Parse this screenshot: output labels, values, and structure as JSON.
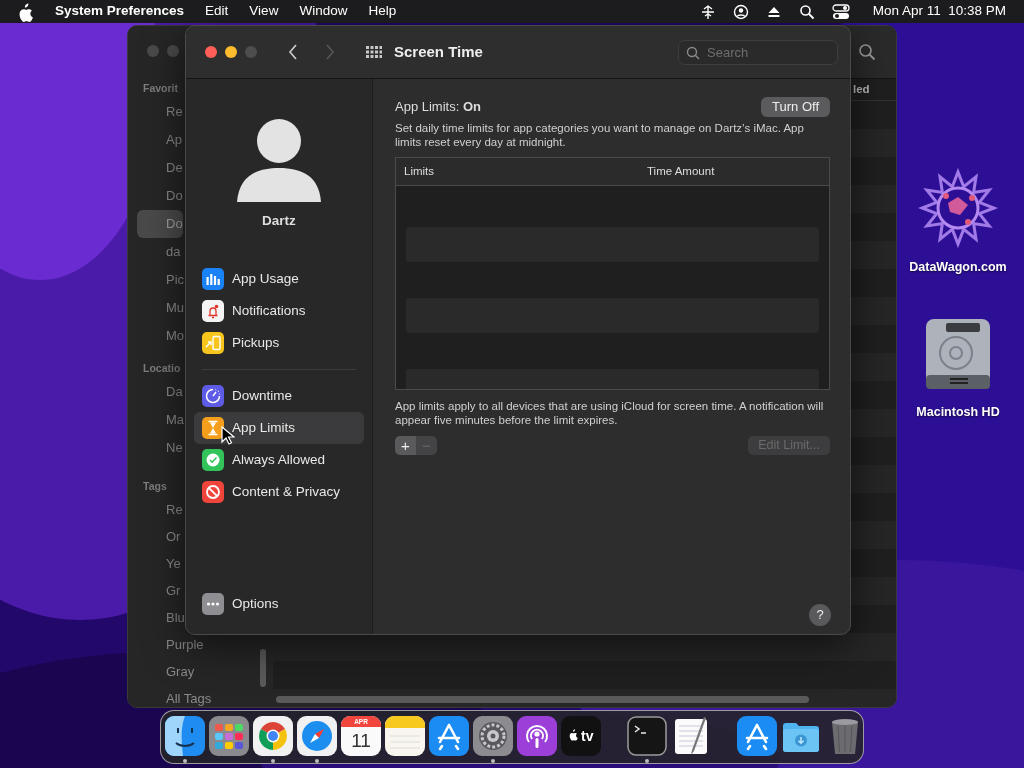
{
  "menu_bar": {
    "app_name": "System Preferences",
    "menus": [
      "Edit",
      "View",
      "Window",
      "Help"
    ],
    "clock": "Mon Apr 11  10:38 PM"
  },
  "finder_window": {
    "active": false,
    "sidebar": [
      {
        "heading": "Favorit",
        "items": [
          {
            "label": "Re",
            "selected": false
          },
          {
            "label": "Ap",
            "selected": false
          },
          {
            "label": "De",
            "selected": false
          },
          {
            "label": "Do",
            "selected": false
          },
          {
            "label": "Do",
            "selected": true
          },
          {
            "label": "da",
            "selected": false
          },
          {
            "label": "Pic",
            "selected": false
          },
          {
            "label": "Mu",
            "selected": false
          },
          {
            "label": "Mo",
            "selected": false
          }
        ]
      },
      {
        "heading": "Locatio",
        "items": [
          {
            "label": "Da",
            "selected": false
          },
          {
            "label": "Ma",
            "selected": false
          },
          {
            "label": "Ne",
            "selected": false
          }
        ]
      },
      {
        "heading": "Tags",
        "items": [
          {
            "label": "Re",
            "selected": false
          },
          {
            "label": "Or",
            "selected": false
          },
          {
            "label": "Ye",
            "selected": false
          },
          {
            "label": "Gr",
            "selected": false
          },
          {
            "label": "Blu",
            "selected": false
          },
          {
            "label": "Purple",
            "selected": false
          },
          {
            "label": "Gray",
            "selected": false
          },
          {
            "label": "All Tags",
            "selected": false
          }
        ]
      }
    ],
    "column_heading": "led"
  },
  "prefs_window": {
    "title": "Screen Time",
    "traffic_lights": [
      {
        "kind": "close",
        "enabled": true
      },
      {
        "kind": "minimize",
        "enabled": true
      },
      {
        "kind": "zoom",
        "enabled": false
      }
    ],
    "nav": {
      "back_enabled": true,
      "forward_enabled": false
    },
    "search": {
      "placeholder": "Search"
    },
    "user": {
      "name": "Dartz"
    },
    "sidebar_groups": [
      [
        {
          "label": "App Usage",
          "kind": "usage",
          "selected": false
        },
        {
          "label": "Notifications",
          "kind": "notifications",
          "selected": false
        },
        {
          "label": "Pickups",
          "kind": "pickups",
          "selected": false
        }
      ],
      [
        {
          "label": "Downtime",
          "kind": "downtime",
          "selected": false
        },
        {
          "label": "App Limits",
          "kind": "limits",
          "selected": true
        },
        {
          "label": "Always Allowed",
          "kind": "allowed",
          "selected": false
        },
        {
          "label": "Content & Privacy",
          "kind": "privacy",
          "selected": false
        }
      ]
    ],
    "options": {
      "label": "Options",
      "kind": "options",
      "selected": false
    },
    "content": {
      "status_title": "App Limits: **On**",
      "turn_off_button": "Turn Off",
      "description": "Set daily time limits for app categories you want to manage on Dartz’s iMac. App limits reset every day at midnight.",
      "table": {
        "columns": [
          "Limits",
          "Time Amount"
        ]
      },
      "note": "App limits apply to all devices that are using iCloud for screen time. A notification will appear five minutes before the limit expires.",
      "add_button": {
        "text": "+",
        "disabled": false
      },
      "remove_button": {
        "text": "−",
        "disabled": true
      },
      "edit_button": {
        "text": "Edit Limit...",
        "disabled": true
      },
      "help_button": "?"
    }
  },
  "desktop_icons": [
    {
      "label": "DataWagon.com",
      "kind": "datawagon"
    },
    {
      "label": "Macintosh HD",
      "kind": "disk"
    }
  ],
  "dock": {
    "items": [
      {
        "kind": "finder",
        "running": true
      },
      {
        "kind": "launchpad",
        "running": false
      },
      {
        "kind": "chrome",
        "running": true
      },
      {
        "kind": "safari",
        "running": true
      },
      {
        "kind": "calendar",
        "running": false,
        "month": "APR",
        "day": "11"
      },
      {
        "kind": "notes",
        "running": false
      },
      {
        "kind": "appstore",
        "running": false
      },
      {
        "kind": "settings",
        "running": true
      },
      {
        "kind": "podcasts",
        "running": false
      },
      {
        "kind": "tv",
        "running": false,
        "text": "tv"
      },
      {
        "kind": "separator"
      },
      {
        "kind": "terminal",
        "running": true
      },
      {
        "kind": "textedit",
        "running": false
      },
      {
        "kind": "separator"
      },
      {
        "kind": "appstore",
        "running": false
      },
      {
        "kind": "downloads",
        "running": false
      },
      {
        "kind": "trash",
        "running": false
      }
    ]
  }
}
